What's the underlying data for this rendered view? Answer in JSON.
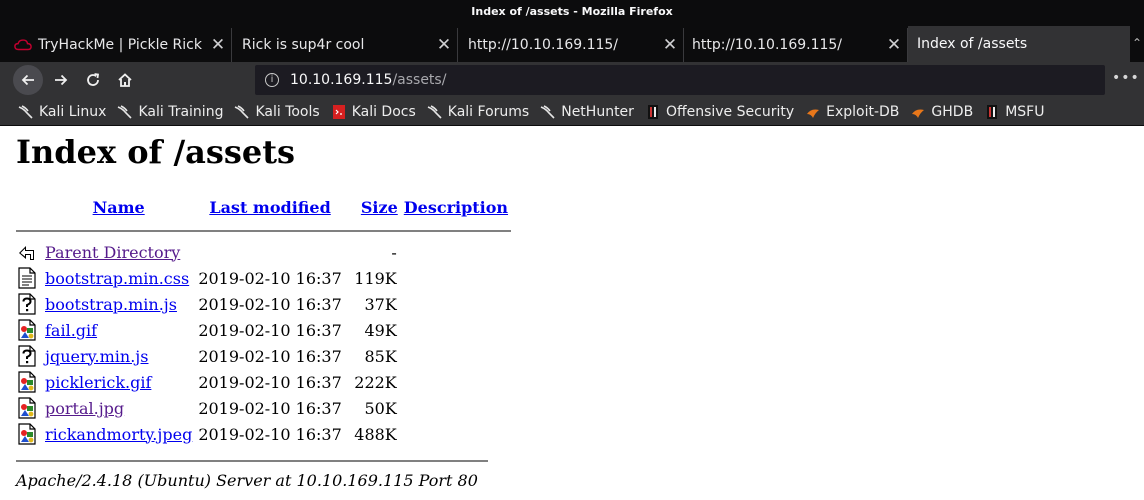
{
  "window": {
    "title": "Index of /assets - Mozilla Firefox"
  },
  "tabs": [
    {
      "label": "TryHackMe | Pickle Rick",
      "active": false
    },
    {
      "label": "Rick is sup4r cool",
      "active": false
    },
    {
      "label": "http://10.10.169.115/",
      "active": false
    },
    {
      "label": "http://10.10.169.115/",
      "active": false
    },
    {
      "label": "Index of /assets",
      "active": true
    }
  ],
  "tab_close_glyph": "✕",
  "url": {
    "host": "10.10.169.115",
    "path": "/assets/"
  },
  "bookmarks": [
    {
      "label": "Kali Linux",
      "icon": "kali-dragon-icon"
    },
    {
      "label": "Kali Training",
      "icon": "kali-dragon-icon"
    },
    {
      "label": "Kali Tools",
      "icon": "kali-dragon-icon"
    },
    {
      "label": "Kali Docs",
      "icon": "kali-docs-icon"
    },
    {
      "label": "Kali Forums",
      "icon": "kali-dragon-icon"
    },
    {
      "label": "NetHunter",
      "icon": "kali-dragon-icon"
    },
    {
      "label": "Offensive Security",
      "icon": "offsec-icon"
    },
    {
      "label": "Exploit-DB",
      "icon": "exploitdb-icon"
    },
    {
      "label": "GHDB",
      "icon": "exploitdb-icon"
    },
    {
      "label": "MSFU",
      "icon": "offsec-icon"
    }
  ],
  "page": {
    "heading": "Index of /assets",
    "columns": {
      "name": "Name",
      "modified": "Last modified",
      "size": "Size",
      "description": "Description"
    },
    "parent": {
      "name": "Parent Directory",
      "size": "-"
    },
    "files": [
      {
        "name": "bootstrap.min.css",
        "modified": "2019-02-10 16:37",
        "size": "119K",
        "icon": "text-file-icon",
        "visited": false
      },
      {
        "name": "bootstrap.min.js",
        "modified": "2019-02-10 16:37",
        "size": "37K",
        "icon": "unknown-file-icon",
        "visited": false
      },
      {
        "name": "fail.gif",
        "modified": "2019-02-10 16:37",
        "size": "49K",
        "icon": "image-file-icon",
        "visited": false
      },
      {
        "name": "jquery.min.js",
        "modified": "2019-02-10 16:37",
        "size": "85K",
        "icon": "unknown-file-icon",
        "visited": false
      },
      {
        "name": "picklerick.gif",
        "modified": "2019-02-10 16:37",
        "size": "222K",
        "icon": "image-file-icon",
        "visited": false
      },
      {
        "name": "portal.jpg",
        "modified": "2019-02-10 16:37",
        "size": "50K",
        "icon": "image-file-icon",
        "visited": true
      },
      {
        "name": "rickandmorty.jpeg",
        "modified": "2019-02-10 16:37",
        "size": "488K",
        "icon": "image-file-icon",
        "visited": false
      }
    ],
    "address": "Apache/2.4.18 (Ubuntu) Server at 10.10.169.115 Port 80"
  }
}
